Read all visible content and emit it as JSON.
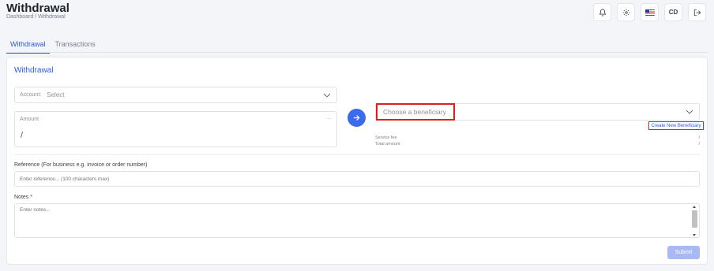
{
  "header": {
    "title": "Withdrawal",
    "breadcrumb": "Dashboard / Withdrawal",
    "actions": {
      "notification_icon": "bell-icon",
      "settings_icon": "gear-icon",
      "language_icon": "us-flag-icon",
      "user_initials": "CD",
      "logout_icon": "logout-icon"
    }
  },
  "tabs": [
    {
      "label": "Withdrawal",
      "active": true
    },
    {
      "label": "Transactions",
      "active": false
    }
  ],
  "form": {
    "title": "Withdrawal",
    "account": {
      "label": "Account:",
      "value": "Select"
    },
    "amount": {
      "label": "Amount",
      "suffix": "...",
      "value": "/"
    },
    "beneficiary": {
      "placeholder": "Choose a beneficiary"
    },
    "create_beneficiary": "Create New Beneficiary",
    "service_fee": {
      "label": "Service fee",
      "value": "/"
    },
    "total_amount": {
      "label": "Total amount",
      "value": "/"
    },
    "reference": {
      "label": "Reference (For business e.g. invoice or order number)",
      "placeholder": "Enter reference... (100 characters max)"
    },
    "notes": {
      "label": "Notes *",
      "placeholder": "Enter notes..."
    },
    "submit_label": "Submit"
  },
  "colors": {
    "accent": "#2f5bdc",
    "arrow_button": "#3a6bea",
    "highlight": "#e01e1e",
    "submit_disabled": "#a9b9f4"
  }
}
